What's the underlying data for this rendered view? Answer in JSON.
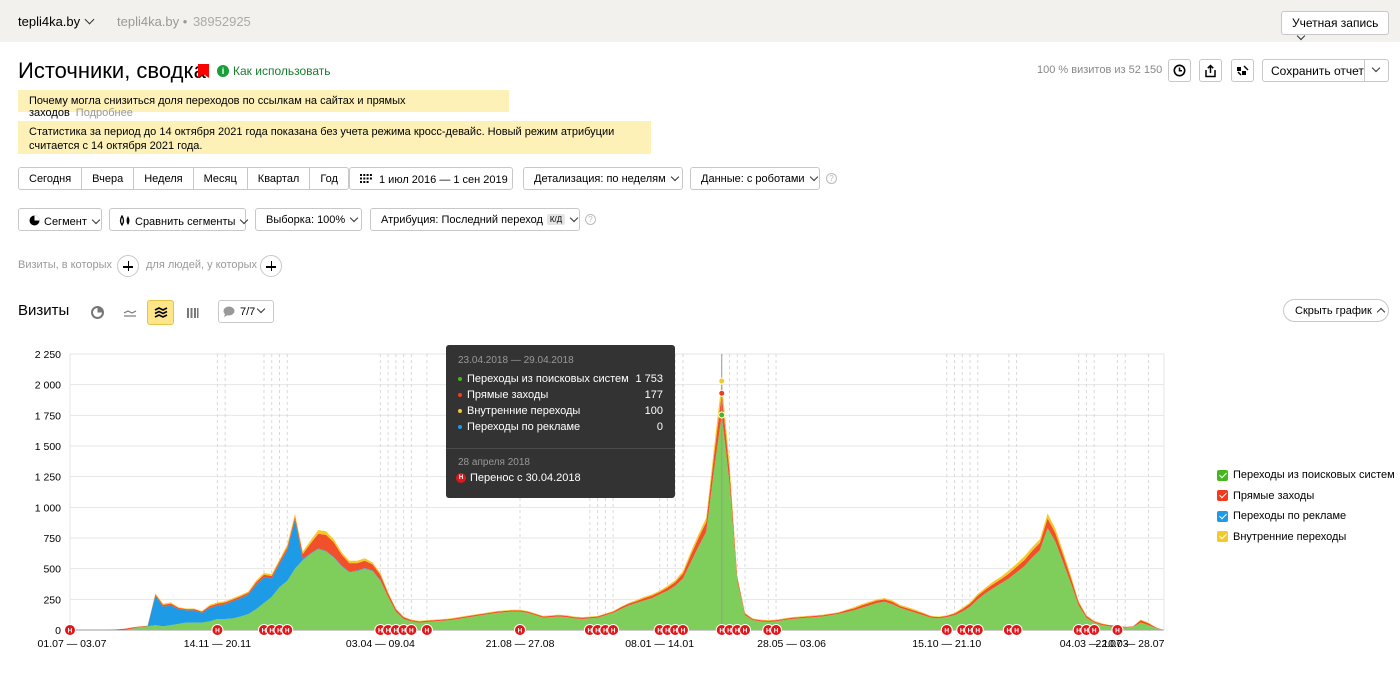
{
  "topbar": {
    "site": "tepli4ka.by",
    "counter_name": "tepli4ka.by",
    "counter_id": "38952925",
    "account_label": "Учетная запись"
  },
  "header": {
    "title": "Источники, сводка",
    "howto_label": "Как использовать",
    "visits_info": "100 % визитов из 52 150",
    "save_label": "Сохранить отчет"
  },
  "notices": {
    "drop_text": "Почему могла снизиться доля переходов по ссылкам на сайтах и прямых заходов",
    "drop_more": "Подробнее",
    "crossdevice_line1": "Статистика за период до 14 октября 2021 года показана без учета режима кросс-девайс. Новый режим атрибуции",
    "crossdevice_line2": "считается с 14 октября 2021 года."
  },
  "period_buttons": [
    "Сегодня",
    "Вчера",
    "Неделя",
    "Месяц",
    "Квартал",
    "Год"
  ],
  "controls": {
    "date_range": "1 июл 2016 — 1 сен 2019",
    "detail": "Детализация: по неделям",
    "data": "Данные: с роботами",
    "segment": "Сегмент",
    "compare": "Сравнить сегменты",
    "sample": "Выборка: 100%",
    "attribution": "Атрибуция: Последний переход",
    "attribution_badge": "К/Д"
  },
  "conditions": {
    "visits_where": "Визиты, в которых",
    "people_where": "для людей, у которых"
  },
  "chart_header": {
    "title": "Визиты",
    "comments": "7/7",
    "hide_chart": "Скрыть график"
  },
  "legend": {
    "items": [
      {
        "label": "Переходы из поисковых систем",
        "color": "#47b620"
      },
      {
        "label": "Прямые заходы",
        "color": "#f23a1f"
      },
      {
        "label": "Переходы по рекламе",
        "color": "#1e9be6"
      },
      {
        "label": "Внутренние переходы",
        "color": "#f5c926"
      }
    ]
  },
  "tooltip": {
    "period": "23.04.2018 — 29.04.2018",
    "rows": [
      {
        "name": "Переходы из поисковых систем",
        "value": "1 753",
        "color": "#47b620"
      },
      {
        "name": "Прямые заходы",
        "value": "177",
        "color": "#f23a1f"
      },
      {
        "name": "Внутренние переходы",
        "value": "100",
        "color": "#f5c926"
      },
      {
        "name": "Переходы по рекламе",
        "value": "0",
        "color": "#1e9be6"
      }
    ],
    "annotation_date": "28 апреля 2018",
    "annotation_text": "Перенос с 30.04.2018",
    "annotation_mark": "Н"
  },
  "chart_data": {
    "type": "area",
    "stacked": true,
    "ylim": [
      0,
      2250
    ],
    "y_ticks": [
      "0",
      "250",
      "500",
      "750",
      "1 000",
      "1 250",
      "1 500",
      "1 750",
      "2 000",
      "2 250"
    ],
    "x_labels": [
      "01.07 — 03.07",
      "14.11 — 20.11",
      "03.04 — 09.04",
      "21.08 — 27.08",
      "08.01 — 14.01",
      "28.05 — 03.06",
      "15.10 — 21.10",
      "04.03 — 10.03",
      "22.07 — 28.07"
    ],
    "annotation_mark": "Н",
    "series": [
      {
        "name": "Переходы из поисковых систем",
        "color": "#7fcd5a",
        "values": [
          0,
          0,
          0,
          0,
          0,
          0,
          0,
          0,
          10,
          25,
          30,
          40,
          30,
          40,
          50,
          60,
          60,
          60,
          70,
          90,
          90,
          95,
          110,
          130,
          170,
          220,
          270,
          350,
          400,
          500,
          570,
          620,
          660,
          640,
          590,
          520,
          470,
          480,
          500,
          480,
          400,
          270,
          150,
          90,
          70,
          60,
          65,
          70,
          75,
          80,
          90,
          100,
          110,
          120,
          130,
          140,
          145,
          150,
          150,
          140,
          120,
          100,
          105,
          110,
          105,
          95,
          90,
          95,
          100,
          120,
          140,
          170,
          200,
          220,
          240,
          260,
          290,
          320,
          360,
          420,
          550,
          680,
          800,
          1300,
          1753,
          1200,
          400,
          120,
          80,
          70,
          65,
          70,
          80,
          90,
          95,
          100,
          105,
          110,
          120,
          130,
          145,
          160,
          180,
          200,
          220,
          230,
          210,
          180,
          160,
          140,
          120,
          100,
          95,
          105,
          120,
          150,
          190,
          250,
          300,
          340,
          380,
          420,
          470,
          520,
          590,
          650,
          830,
          720,
          550,
          380,
          200,
          100,
          60,
          40,
          30,
          25,
          20,
          25,
          60,
          40,
          15,
          0
        ]
      },
      {
        "name": "Переходы по рекламе",
        "color": "#1e9be6",
        "values": [
          0,
          0,
          0,
          0,
          0,
          0,
          0,
          0,
          0,
          0,
          0,
          240,
          160,
          160,
          120,
          100,
          100,
          80,
          110,
          110,
          120,
          140,
          150,
          160,
          200,
          210,
          150,
          190,
          250,
          400,
          10,
          5,
          5,
          5,
          5,
          5,
          5,
          5,
          5,
          5,
          5,
          0,
          0,
          0,
          0,
          0,
          0,
          0,
          0,
          0,
          0,
          0,
          0,
          0,
          0,
          0,
          0,
          0,
          0,
          0,
          0,
          0,
          0,
          0,
          0,
          0,
          0,
          0,
          0,
          0,
          0,
          0,
          0,
          0,
          0,
          0,
          0,
          0,
          0,
          0,
          0,
          0,
          0,
          0,
          0,
          0,
          0,
          0,
          0,
          0,
          0,
          0,
          0,
          0,
          0,
          0,
          0,
          0,
          0,
          0,
          0,
          0,
          0,
          0,
          0,
          0,
          0,
          0,
          0,
          0,
          0,
          0,
          0,
          0,
          0,
          0,
          0,
          0,
          0,
          0,
          0,
          0,
          0,
          0,
          0,
          0,
          0,
          0,
          0,
          0,
          0,
          0,
          0,
          0,
          0,
          0,
          0,
          0,
          0,
          0,
          0,
          0,
          0
        ]
      },
      {
        "name": "Прямые заходы",
        "color": "#f2502b",
        "values": [
          0,
          0,
          0,
          0,
          0,
          0,
          5,
          10,
          10,
          5,
          5,
          10,
          15,
          15,
          10,
          10,
          10,
          10,
          15,
          15,
          15,
          15,
          15,
          15,
          20,
          20,
          20,
          20,
          25,
          25,
          40,
          80,
          120,
          130,
          120,
          90,
          70,
          60,
          60,
          50,
          45,
          30,
          20,
          15,
          10,
          10,
          10,
          10,
          10,
          10,
          10,
          10,
          10,
          10,
          10,
          10,
          10,
          10,
          10,
          10,
          10,
          10,
          10,
          10,
          10,
          10,
          10,
          10,
          10,
          10,
          10,
          15,
          15,
          15,
          20,
          20,
          20,
          25,
          30,
          40,
          60,
          70,
          80,
          120,
          177,
          100,
          30,
          15,
          10,
          10,
          10,
          10,
          10,
          10,
          10,
          10,
          10,
          10,
          10,
          10,
          15,
          15,
          20,
          20,
          20,
          20,
          20,
          15,
          15,
          15,
          15,
          10,
          10,
          10,
          15,
          20,
          25,
          30,
          30,
          35,
          35,
          40,
          45,
          50,
          55,
          60,
          80,
          70,
          60,
          45,
          25,
          15,
          10,
          10,
          10,
          10,
          5,
          5,
          20,
          15,
          5,
          0
        ]
      },
      {
        "name": "Внутренние переходы",
        "color": "#f5c926",
        "values": [
          0,
          0,
          0,
          0,
          0,
          0,
          0,
          0,
          0,
          0,
          0,
          10,
          10,
          10,
          5,
          5,
          5,
          5,
          10,
          10,
          10,
          10,
          10,
          10,
          15,
          15,
          15,
          15,
          20,
          25,
          20,
          25,
          30,
          30,
          25,
          20,
          20,
          20,
          20,
          15,
          15,
          10,
          5,
          5,
          5,
          5,
          5,
          5,
          5,
          5,
          5,
          5,
          5,
          5,
          5,
          5,
          5,
          5,
          5,
          5,
          5,
          5,
          5,
          5,
          5,
          5,
          5,
          5,
          5,
          5,
          5,
          5,
          5,
          10,
          10,
          10,
          10,
          15,
          15,
          20,
          25,
          30,
          35,
          60,
          100,
          60,
          10,
          5,
          5,
          5,
          5,
          5,
          5,
          5,
          5,
          5,
          5,
          5,
          5,
          5,
          5,
          10,
          10,
          10,
          10,
          10,
          10,
          10,
          10,
          10,
          5,
          5,
          5,
          5,
          5,
          10,
          10,
          15,
          15,
          20,
          20,
          25,
          25,
          30,
          30,
          30,
          40,
          35,
          30,
          20,
          10,
          5,
          5,
          5,
          0,
          0,
          0,
          0,
          5,
          5,
          0,
          0
        ]
      }
    ]
  }
}
